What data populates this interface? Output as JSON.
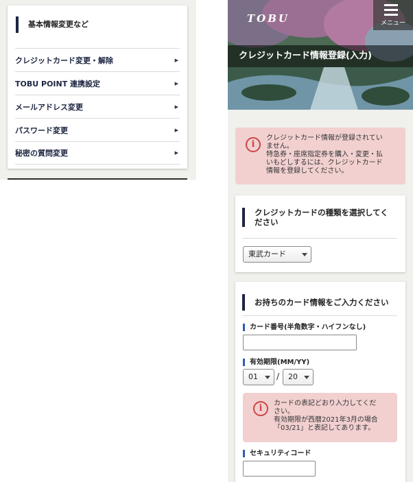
{
  "left": {
    "section_title": "基本情報変更など",
    "menu": [
      "クレジットカード変更・解除",
      "TOBU POINT 連携設定",
      "メールアドレス変更",
      "パスワード変更",
      "秘密の質問変更"
    ],
    "arrow": "▶"
  },
  "header": {
    "logo": "TOBU",
    "menu_label": "メニュー",
    "page_title": "クレジットカード情報登録(入力)"
  },
  "alert_top": {
    "icon": "i",
    "lines": [
      "クレジットカード情報が登録されてい",
      "ません。",
      "特急券・座席指定券を購入・変更・払",
      "いもどしするには、クレジットカード",
      "情報を登録してください。"
    ]
  },
  "card_type": {
    "heading_line1": "クレジットカードの種類を選択してく",
    "heading_line2": "ださい",
    "selected": "東武カード"
  },
  "card_info": {
    "heading": "お持ちのカード情報をご入力ください",
    "number_label": "カード番号(半角数字・ハイフンなし)",
    "number_value": "",
    "expiry_label": "有効期限(MM/YY)",
    "expiry_month": "01",
    "expiry_sep": "/",
    "expiry_year": "20",
    "hint": {
      "icon": "i",
      "lines": [
        "カードの表記どおり入力してくだ",
        "さい。",
        "有効期限が西暦2021年3月の場合",
        "「03/21」と表記してあります。"
      ]
    },
    "security_label": "セキュリティコード",
    "security_value": ""
  },
  "colors": {
    "navy_accent": "#1c2540",
    "label_accent": "#2f5bb7",
    "alert_bg": "#f2d0d0",
    "alert_icon": "#cc4444",
    "panel_bg": "#f0f0ec"
  }
}
